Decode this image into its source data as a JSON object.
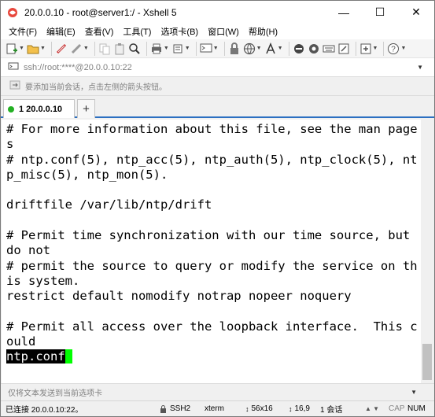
{
  "window": {
    "title": "20.0.0.10 - root@server1:/ - Xshell 5",
    "min_glyph": "—",
    "max_glyph": "☐",
    "close_glyph": "✕"
  },
  "menu": [
    {
      "label": "文件(F)"
    },
    {
      "label": "编辑(E)"
    },
    {
      "label": "查看(V)"
    },
    {
      "label": "工具(T)"
    },
    {
      "label": "选项卡(B)"
    },
    {
      "label": "窗口(W)"
    },
    {
      "label": "帮助(H)"
    }
  ],
  "address": {
    "value": "ssh://root:****@20.0.0.10:22"
  },
  "hint": {
    "text": "要添加当前会话，点击左侧的箭头按钮。"
  },
  "tabs": [
    {
      "label": "1 20.0.0.10"
    }
  ],
  "tab_add": "+",
  "terminal": {
    "lines": [
      "# For more information about this file, see the man page",
      "s",
      "# ntp.conf(5), ntp_acc(5), ntp_auth(5), ntp_clock(5), nt",
      "p_misc(5), ntp_mon(5).",
      "",
      "driftfile /var/lib/ntp/drift",
      "",
      "# Permit time synchronization with our time source, but",
      "do not",
      "# permit the source to query or modify the service on th",
      "is system.",
      "restrict default nomodify notrap nopeer noquery",
      "",
      "# Permit all access over the loopback interface.  This c",
      "ould"
    ],
    "command_line": "ntp.conf"
  },
  "input_bar": {
    "placeholder": "仅将文本发送到当前选项卡"
  },
  "status": {
    "connection": "已连接 20.0.0.10:22。",
    "protocol": "SSH2",
    "terminal_type": "xterm",
    "size": "56x16",
    "cursor_pos": "16,9",
    "sessions": "1 会话",
    "caps": "CAP",
    "num": "NUM"
  },
  "colors": {
    "tab_accent": "#2c6fc1",
    "connected_dot": "#23b023",
    "cursor": "#00ff00"
  }
}
